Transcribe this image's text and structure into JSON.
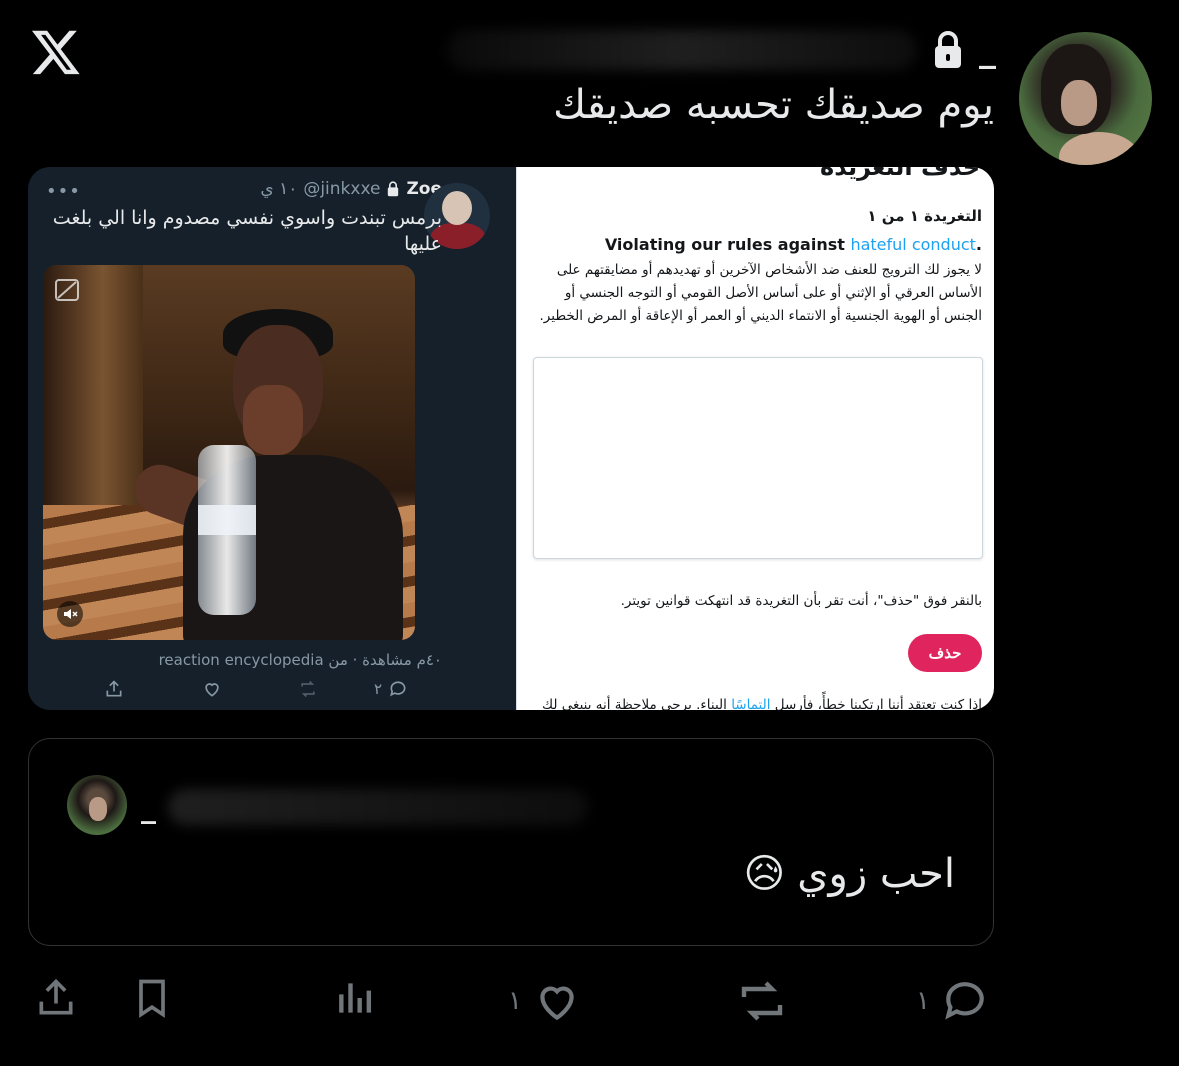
{
  "app": {
    "logo": "x-logo-icon"
  },
  "header": {
    "handle_mark": "_",
    "lock": "lock-icon",
    "tweet_text": "يوم صديقك تحسبه صديقك"
  },
  "media_left": {
    "author_name": "Zoe",
    "author_handle": "@jinkxxe",
    "time": "١٠ ي",
    "more": "•••",
    "text": "برمس تبندت واسوي نفسي مصدوم وانا الي بلغت عليها",
    "views_line": "٤٠م مشاهدة · من reaction encyclopedia",
    "replies": "٢",
    "icons": {
      "reply": "reply-icon",
      "retweet": "retweet-icon",
      "like": "like-icon",
      "share": "share-icon",
      "mute": "mute-icon",
      "captions": "captions-icon"
    }
  },
  "media_right": {
    "title": "حذف التغريدة",
    "counter": "التغريدة ١ من ١",
    "rule_prefix": "Violating our rules against ",
    "rule_link": "hateful conduct",
    "rule_suffix": ".",
    "description": "لا يجوز لك الترويج للعنف ضد الأشخاص الآخرين أو تهديدهم أو مضايقتهم على الأساس العرقي أو الإثني أو على أساس الأصل القومي أو التوجه الجنسي أو الجنس أو الهوية الجنسية أو الانتماء الديني أو العمر أو الإعاقة أو المرض الخطير.",
    "confirm_text": "بالنقر فوق \"حذف\"، أنت تقر بأن التغريدة قد انتهكت قوانين تويتر.",
    "delete_button": "حذف",
    "footer_prefix": "إذا كنت تعتقد أننا ارتكبنا خطأً، فأرسل ",
    "footer_link": "التماسًا",
    "footer_suffix": " البناء. يرجى ملاحظة أنه ينبغي لك"
  },
  "quote": {
    "handle_mark": "_",
    "text": "احب زوي",
    "emoji": "😥"
  },
  "actions": {
    "replies": "١",
    "likes": "١",
    "icons": {
      "reply": "reply-icon",
      "retweet": "retweet-icon",
      "like": "like-icon",
      "views": "views-icon",
      "bookmark": "bookmark-icon",
      "share": "share-icon"
    }
  },
  "colors": {
    "background": "#000000",
    "card_dark": "#15202b",
    "link": "#1da1f2",
    "delete": "#e0245e",
    "muted": "#71767b"
  }
}
